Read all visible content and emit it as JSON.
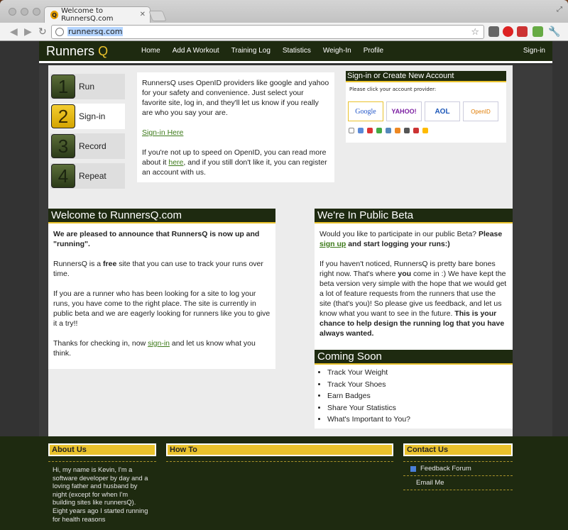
{
  "browser": {
    "tab_title": "Welcome to RunnersQ.com",
    "url": "runnersq.com"
  },
  "header": {
    "logo_main": "Runners",
    "logo_q": "Q",
    "nav": [
      "Home",
      "Add A Workout",
      "Training Log",
      "Statistics",
      "Weigh-In",
      "Profile"
    ],
    "signin": "Sign-in"
  },
  "steps": [
    {
      "num": "1",
      "label": "Run"
    },
    {
      "num": "2",
      "label": "Sign-in"
    },
    {
      "num": "3",
      "label": "Record"
    },
    {
      "num": "4",
      "label": "Repeat"
    }
  ],
  "intro": {
    "p1": "RunnersQ uses OpenID providers like google and yahoo for your safety and convenience. Just select your favorite site, log in, and they'll let us know if you really are who you say your are.",
    "signin_link": "Sign-in Here",
    "p3_a": "If you're not up to speed on OpenID, you can read more about it ",
    "p3_link": "here",
    "p3_b": ", and if you still don't like it, you can register an account with us."
  },
  "signbox": {
    "title": "Sign-in or Create New Account",
    "sub": "Please click your account provider:",
    "providers": [
      "Google",
      "YAHOO!",
      "AOL",
      "OpenID"
    ]
  },
  "welcome": {
    "title": "Welcome to RunnersQ.com",
    "p1": "We are pleased to announce that RunnersQ is now up and \"running\".",
    "p2_a": "RunnersQ is a ",
    "p2_b": "free",
    "p2_c": " site that you can use to track your runs over time.",
    "p3": "If you are a runner who has been looking for a site to log your runs, you have come to the right place. The site is currently in public beta and we are eagerly looking for runners like you to give it a try!!",
    "p4_a": "Thanks for checking in, now ",
    "p4_link": "sign-in",
    "p4_b": " and let us know what you think."
  },
  "beta": {
    "title": "We're In Public Beta",
    "p1_a": "Would you like to participate in our public Beta? ",
    "p1_b": "Please ",
    "p1_link": "sign up",
    "p1_c": " and start logging your runs:)",
    "p2_a": "If you haven't noticed, RunnersQ is pretty bare bones right now. That's where ",
    "p2_b": "you",
    "p2_c": " come in :) We have kept the beta version very simple with the hope that we would get a lot of feature requests from the runners that use the site (that's you)! So please give us feedback, and let us know what you want to see in the future. ",
    "p2_d": "This is your chance to help design the running log that you have always wanted."
  },
  "coming": {
    "title": "Coming Soon",
    "items": [
      "Track Your Weight",
      "Track Your Shoes",
      "Earn Badges",
      "Share Your Statistics",
      "What's Important to You?"
    ]
  },
  "footer": {
    "about_title": "About Us",
    "about_text": "Hi, my name is Kevin, I'm a software developer by day and a loving father and husband by night (except for when I'm building sites like runnersQ). Eight years ago I started running for health reasons",
    "howto_title": "How To",
    "contact_title": "Contact Us",
    "contact_items": [
      "Feedback Forum",
      "Email Me"
    ]
  }
}
